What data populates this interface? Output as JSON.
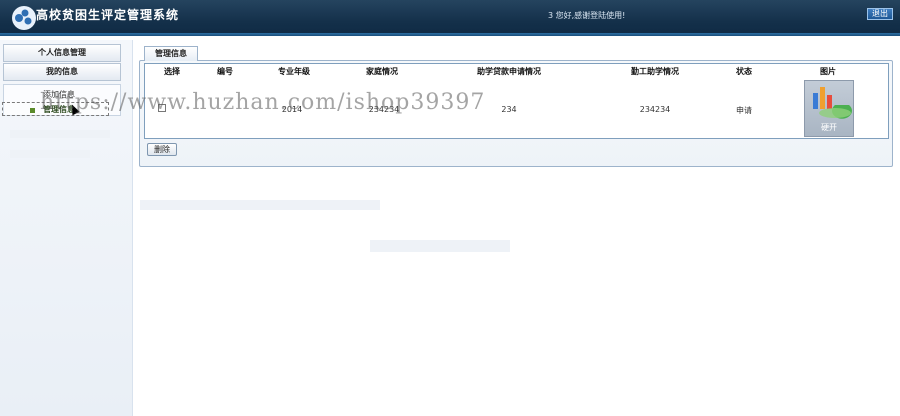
{
  "header": {
    "title": "高校贫困生评定管理系统",
    "welcome": "3 您好,感谢登陆使用!",
    "logout_label": "退出"
  },
  "sidebar": {
    "sections": [
      {
        "label": "个人信息管理"
      },
      {
        "label": "我的信息"
      }
    ],
    "items": [
      {
        "label": "添加信息"
      },
      {
        "label": "管理信息",
        "active": true
      }
    ]
  },
  "main": {
    "tab_label": "管理信息",
    "columns": [
      "选择",
      "编号",
      "专业年级",
      "家庭情况",
      "助学贷款申请情况",
      "勤工助学情况",
      "状态",
      "图片"
    ],
    "rows": [
      {
        "id": "",
        "major_grade": "2014",
        "family": "234234",
        "loan": "234",
        "work_study": "234234",
        "status": "申请",
        "image_caption": "硬开"
      }
    ],
    "delete_label": "删除"
  },
  "watermark": "https://www.huzhan.com/ishop39397",
  "colors": {
    "header_bg": "#14304a",
    "border": "#9db3cb",
    "active_item": "#5a8a2a"
  }
}
